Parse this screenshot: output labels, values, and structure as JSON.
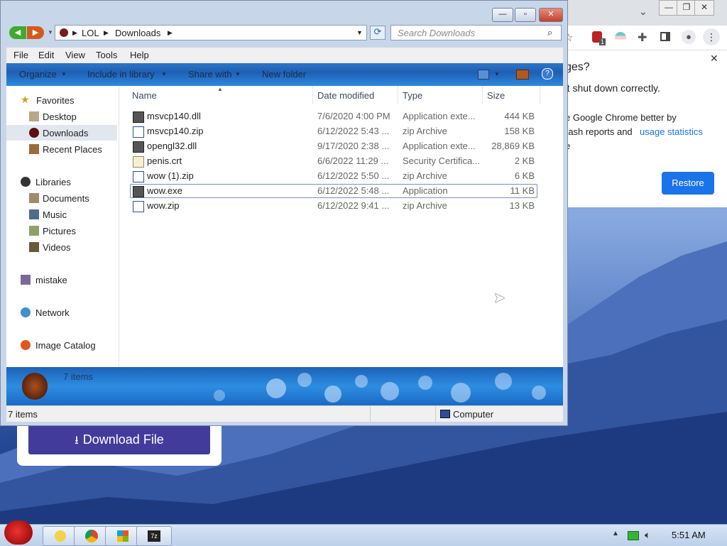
{
  "explorer": {
    "address": {
      "root": "LOL",
      "current": "Downloads"
    },
    "search_placeholder": "Search Downloads",
    "menu": [
      "File",
      "Edit",
      "View",
      "Tools",
      "Help"
    ],
    "toolbar": {
      "organize": "Organize",
      "include": "Include in library",
      "share": "Share with",
      "new_folder": "New folder"
    },
    "nav": {
      "favorites": "Favorites",
      "desktop": "Desktop",
      "downloads": "Downloads",
      "recent": "Recent Places",
      "libraries": "Libraries",
      "documents": "Documents",
      "music": "Music",
      "pictures": "Pictures",
      "videos": "Videos",
      "mistake": "mistake",
      "network": "Network",
      "image_catalog": "Image Catalog"
    },
    "columns": {
      "name": "Name",
      "date": "Date modified",
      "type": "Type",
      "size": "Size"
    },
    "files": [
      {
        "name": "msvcp140.dll",
        "date": "7/6/2020 4:00 PM",
        "type": "Application exte...",
        "size": "444 KB"
      },
      {
        "name": "msvcp140.zip",
        "date": "6/12/2022 5:43 ...",
        "type": "zip Archive",
        "size": "158 KB"
      },
      {
        "name": "opengl32.dll",
        "date": "9/17/2020 2:38 ...",
        "type": "Application exte...",
        "size": "28,869 KB"
      },
      {
        "name": "penis.crt",
        "date": "6/6/2022 11:29 ...",
        "type": "Security Certifica...",
        "size": "2 KB"
      },
      {
        "name": "wow (1).zip",
        "date": "6/12/2022 5:50 ...",
        "type": "zip Archive",
        "size": "6 KB"
      },
      {
        "name": "wow.exe",
        "date": "6/12/2022 5:48 ...",
        "type": "Application",
        "size": "11 KB"
      },
      {
        "name": "wow.zip",
        "date": "6/12/2022 9:41 ...",
        "type": "zip Archive",
        "size": "13 KB"
      }
    ],
    "detail_count": "7 items",
    "status_count": "7 items",
    "status_location": "Computer"
  },
  "chrome": {
    "crash_title": "ges?",
    "crash_line1": "'t shut down correctly.",
    "crash_line2": "e Google Chrome better by",
    "crash_line3a": "rash reports and",
    "crash_line3b": "usage statistics",
    "crash_line4": "e",
    "restore_label": "Restore",
    "close_glyph": "✕",
    "ext_badge": "1"
  },
  "download": {
    "label": "Download File"
  },
  "taskbar": {
    "time": "5:51 AM"
  },
  "colors": {
    "accent": "#1a73e8",
    "download_button": "#433b9c",
    "selection": "#e2e7ef"
  }
}
